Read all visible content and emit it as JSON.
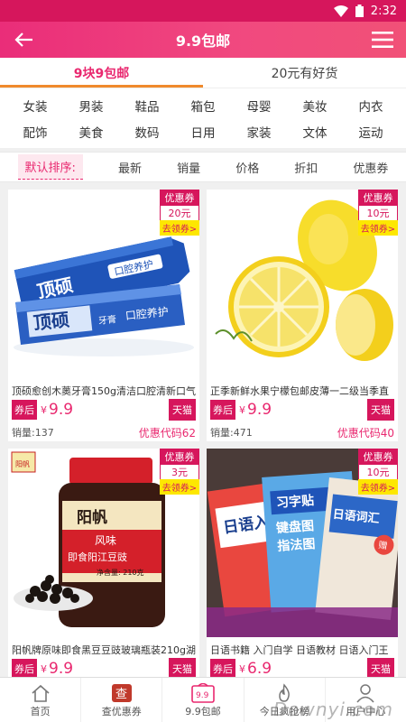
{
  "status_bar": {
    "time": "2:32"
  },
  "header": {
    "title": "9.9包邮"
  },
  "tabs": [
    {
      "label": "9块9包邮"
    },
    {
      "label": "20元有好货"
    }
  ],
  "categories": {
    "row1": [
      "女装",
      "男装",
      "鞋品",
      "箱包",
      "母婴",
      "美妆",
      "内衣"
    ],
    "row2": [
      "配饰",
      "美食",
      "数码",
      "日用",
      "家装",
      "文体",
      "运动"
    ]
  },
  "sort_options": [
    "默认排序:",
    "最新",
    "销量",
    "价格",
    "折扣",
    "优惠券"
  ],
  "coupon_labels": {
    "title": "优惠券",
    "get": "去领券>"
  },
  "price_tags": {
    "after": "券后",
    "yen": "¥",
    "tmall": "天猫"
  },
  "products": [
    {
      "name": "顶硕愈创木薁牙膏150g清洁口腔清新口气",
      "coupon": "20元",
      "price": "9.9",
      "sales": "销量:137",
      "code": "优惠代码62",
      "img_text": {
        "brand": "顶硕",
        "sub": "口腔养护",
        "tag": "牙膏"
      }
    },
    {
      "name": "正季新鲜水果宁檬包邮皮薄一二级当季直",
      "coupon": "10元",
      "price": "9.9",
      "sales": "销量:471",
      "code": "优惠代码40"
    },
    {
      "name": "阳帆牌原味即食黑豆豆豉玻璃瓶装210g湖",
      "coupon": "3元",
      "price": "9.9",
      "img_text": {
        "logo": "阳帆",
        "brand": "阳帆",
        "flavor": "风味",
        "product": "即食阳江豆豉",
        "weight": "净含量: 210克"
      }
    },
    {
      "name": "日语书籍 入门自学 日语教材 日语入门王",
      "coupon": "10元",
      "price": "6.9",
      "img_text": {
        "book1": "日语入门",
        "book2": "习字贴",
        "book3": "日语词汇",
        "book4": "键盘图",
        "book5": "指法图",
        "badge": "赠"
      }
    }
  ],
  "bottom_nav": [
    "首页",
    "查优惠券",
    "9.9包邮",
    "今日疯抢榜",
    "用户中心"
  ],
  "bottom_icons": {
    "coupon": "查",
    "nine": "9.9"
  },
  "watermark": "Downyi.com",
  "colors": {
    "primary": "#d6165c",
    "accent": "#e9286f",
    "tab_underline": "#f08a2c",
    "coupon_get": "#fde700"
  }
}
